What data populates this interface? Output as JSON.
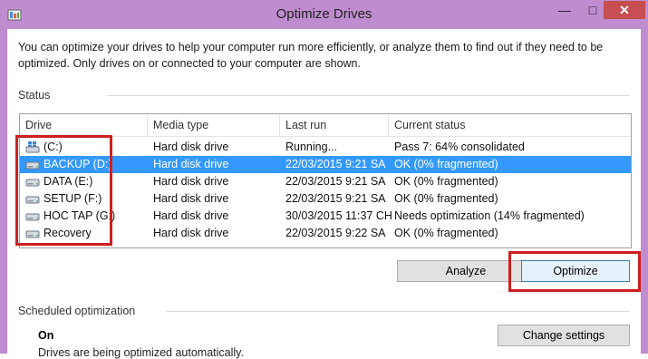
{
  "window": {
    "title": "Optimize Drives",
    "minimize_label": "—",
    "maximize_label": "□",
    "close_label": "✕"
  },
  "intro": "You can optimize your drives to help your computer run more efficiently, or analyze them to find out if they need to be optimized. Only drives on or connected to your computer are shown.",
  "status_section": {
    "label": "Status"
  },
  "table": {
    "columns": [
      "Drive",
      "Media type",
      "Last run",
      "Current status"
    ],
    "rows": [
      {
        "drive": "(C:)",
        "icon": "windows-drive-icon",
        "media": "Hard disk drive",
        "last_run": "Running...",
        "status": "Pass 7: 64% consolidated",
        "selected": false
      },
      {
        "drive": "BACKUP (D:)",
        "icon": "drive-icon",
        "media": "Hard disk drive",
        "last_run": "22/03/2015 9:21 SA",
        "status": "OK (0% fragmented)",
        "selected": true
      },
      {
        "drive": "DATA (E:)",
        "icon": "drive-icon",
        "media": "Hard disk drive",
        "last_run": "22/03/2015 9:21 SA",
        "status": "OK (0% fragmented)",
        "selected": false
      },
      {
        "drive": "SETUP (F:)",
        "icon": "drive-icon",
        "media": "Hard disk drive",
        "last_run": "22/03/2015 9:21 SA",
        "status": "OK (0% fragmented)",
        "selected": false
      },
      {
        "drive": "HOC TAP (G:)",
        "icon": "drive-icon",
        "media": "Hard disk drive",
        "last_run": "30/03/2015 11:37 CH",
        "status": "Needs optimization (14% fragmented)",
        "selected": false
      },
      {
        "drive": "Recovery",
        "icon": "drive-icon",
        "media": "Hard disk drive",
        "last_run": "22/03/2015 9:22 SA",
        "status": "OK (0% fragmented)",
        "selected": false
      }
    ]
  },
  "buttons": {
    "analyze": "Analyze",
    "optimize": "Optimize",
    "change_settings": "Change settings"
  },
  "scheduled": {
    "label": "Scheduled optimization",
    "state": "On",
    "detail": "Drives are being optimized automatically."
  },
  "colors": {
    "highlight": "#3399ff",
    "annotation": "#cc1f1f",
    "title_bar": "#c08cd0"
  }
}
